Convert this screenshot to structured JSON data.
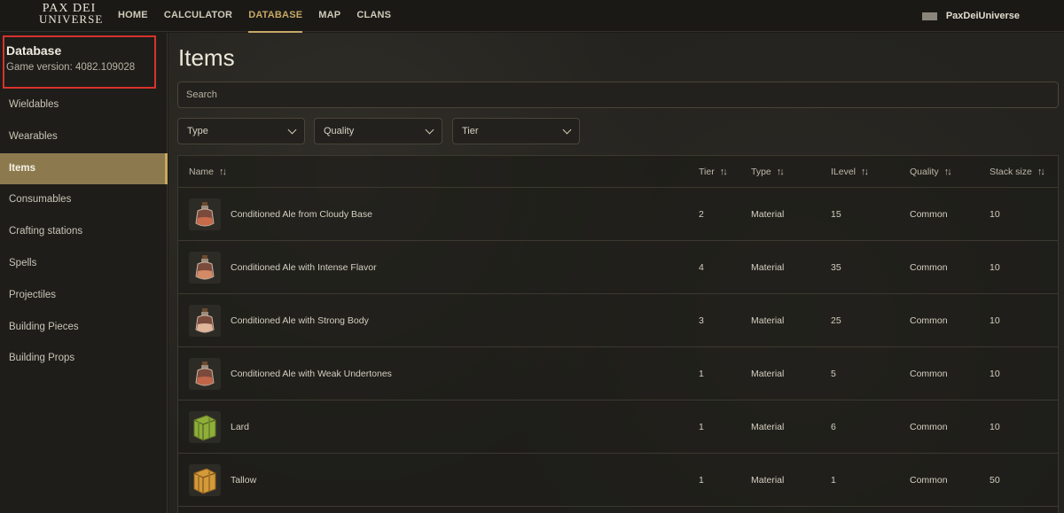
{
  "nav": {
    "logo_line1": "PAX DEI",
    "logo_line2": "UNIVERSE",
    "items": [
      "HOME",
      "CALCULATOR",
      "DATABASE",
      "MAP",
      "CLANS"
    ],
    "active": "DATABASE",
    "user_name": "PaxDeiUniverse"
  },
  "sidebar": {
    "title": "Database",
    "version": "Game version: 4082.109028",
    "items": [
      {
        "label": "Wieldables"
      },
      {
        "label": "Wearables"
      },
      {
        "label": "Items",
        "active": true
      },
      {
        "label": "Consumables"
      },
      {
        "label": "Crafting stations"
      },
      {
        "label": "Spells"
      },
      {
        "label": "Projectiles"
      },
      {
        "label": "Building Pieces"
      },
      {
        "label": "Building Props"
      }
    ]
  },
  "main": {
    "title": "Items",
    "search_placeholder": "Search",
    "filters": [
      "Type",
      "Quality",
      "Tier"
    ]
  },
  "table": {
    "columns": [
      "Name",
      "Tier",
      "Type",
      "ILevel",
      "Quality",
      "Stack size"
    ],
    "rows": [
      {
        "name": "Conditioned Ale from Cloudy Base",
        "tier": "2",
        "type": "Material",
        "ilevel": "15",
        "quality": "Common",
        "stack": "10",
        "icon": "potion-bottle-icon"
      },
      {
        "name": "Conditioned Ale with Intense Flavor",
        "tier": "4",
        "type": "Material",
        "ilevel": "35",
        "quality": "Common",
        "stack": "10",
        "icon": "potion-bottle-icon"
      },
      {
        "name": "Conditioned Ale with Strong Body",
        "tier": "3",
        "type": "Material",
        "ilevel": "25",
        "quality": "Common",
        "stack": "10",
        "icon": "potion-bottle-icon"
      },
      {
        "name": "Conditioned Ale with Weak Undertones",
        "tier": "1",
        "type": "Material",
        "ilevel": "5",
        "quality": "Common",
        "stack": "10",
        "icon": "potion-bottle-icon"
      },
      {
        "name": "Lard",
        "tier": "1",
        "type": "Material",
        "ilevel": "6",
        "quality": "Common",
        "stack": "10",
        "icon": "lard-package-icon"
      },
      {
        "name": "Tallow",
        "tier": "1",
        "type": "Material",
        "ilevel": "1",
        "quality": "Common",
        "stack": "50",
        "icon": "tallow-package-icon"
      }
    ]
  },
  "colors": {
    "accent": "#c7a866",
    "sidebar_active": "#8c7a4e",
    "highlight_border": "#d7332b"
  }
}
